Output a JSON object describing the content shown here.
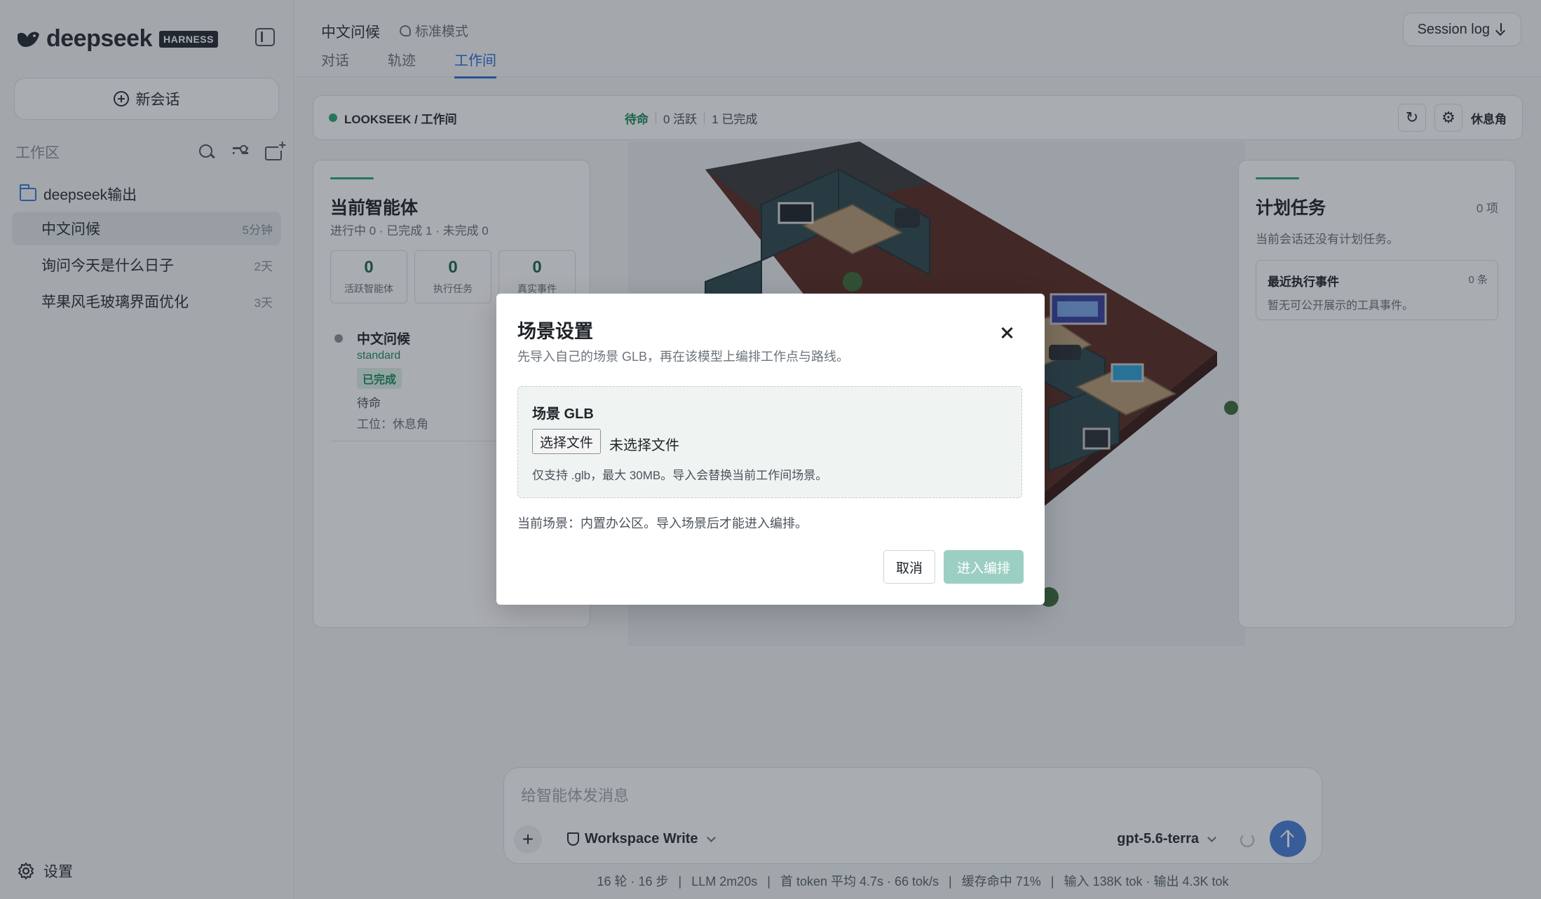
{
  "brand": {
    "name": "deepseek",
    "badge": "HARNESS"
  },
  "sidebar": {
    "new_chat_label": "新会话",
    "workspace_label": "工作区",
    "folder_name": "deepseek输出",
    "sessions": [
      {
        "title": "中文问候",
        "time": "5分钟",
        "active": true
      },
      {
        "title": "询问今天是什么日子",
        "time": "2天",
        "active": false
      },
      {
        "title": "苹果风毛玻璃界面优化",
        "time": "3天",
        "active": false
      }
    ],
    "settings_label": "设置"
  },
  "header": {
    "session_title": "中文问候",
    "mode": "标准模式",
    "tabs": [
      "对话",
      "轨迹",
      "工作间"
    ],
    "active_tab": "工作间",
    "session_log_label": "Session log"
  },
  "workspace_bar": {
    "path": "LOOKSEEK / 工作间",
    "status": "待命",
    "active": "0 活跃",
    "completed": "1 已完成",
    "rest_label": "休息角"
  },
  "agents_panel": {
    "title": "当前智能体",
    "summary": "进行中 0 · 已完成 1 · 未完成 0",
    "stats": [
      {
        "value": "0",
        "label": "活跃智能体"
      },
      {
        "value": "0",
        "label": "执行任务"
      },
      {
        "value": "0",
        "label": "真实事件"
      }
    ],
    "agent": {
      "name": "中文问候",
      "tier": "standard",
      "badge": "已完成",
      "state": "待命",
      "seat": "工位：休息角"
    }
  },
  "tasks_panel": {
    "title": "计划任务",
    "count": "0 项",
    "empty": "当前会话还没有计划任务。",
    "recent_title": "最近执行事件",
    "recent_count": "0 条",
    "recent_empty": "暂无可公开展示的工具事件。"
  },
  "composer": {
    "placeholder": "给智能体发消息",
    "permission": "Workspace Write",
    "model": "gpt-5.6-terra"
  },
  "footer_stats": [
    "16 轮 · 16 步",
    "LLM 2m20s",
    "首 token 平均 4.7s · 66 tok/s",
    "缓存命中 71%",
    "输入 138K tok · 输出 4.3K tok"
  ],
  "modal": {
    "title": "场景设置",
    "subtitle": "先导入自己的场景 GLB，再在该模型上编排工作点与路线。",
    "field_label": "场景 GLB",
    "choose_file": "选择文件",
    "no_file": "未选择文件",
    "hint": "仅支持 .glb，最大 30MB。导入会替换当前工作间场景。",
    "current_scene": "当前场景：内置办公区。导入场景后才能进入编排。",
    "cancel": "取消",
    "enter": "进入编排"
  },
  "colors": {
    "accent_blue": "#2f6fd6",
    "accent_green": "#2aa876",
    "enter_button": "#9ccfc3",
    "send_button": "#4a7fd8"
  }
}
